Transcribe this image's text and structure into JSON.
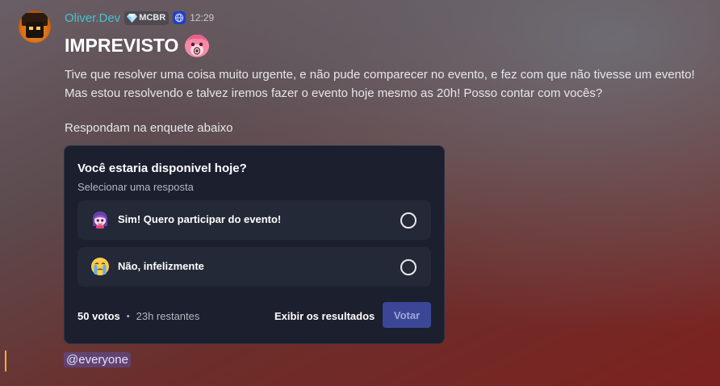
{
  "message": {
    "username": "Oliver.Dev",
    "guild_tag": "MCBR",
    "timestamp": "12:29",
    "title": "IMPREVISTO",
    "lines": [
      "Tive que resolver uma coisa muito urgente, e não pude comparecer no evento, e fez com que não tivesse um evento!",
      "Mas estou resolvendo e talvez iremos fazer o evento hoje mesmo as 20h! Posso contar com vocês?",
      "Respondam na enquete abaixo"
    ],
    "mention": "@everyone"
  },
  "poll": {
    "question": "Você estaria disponivel hoje?",
    "subtitle": "Selecionar uma resposta",
    "options": [
      {
        "label": "Sim! Quero participar do evento!",
        "icon": "anime-girl-emoji"
      },
      {
        "label": "Não, infelizmente",
        "icon": "crying-face-emoji"
      }
    ],
    "votes": "50 votos",
    "separator": "•",
    "remaining": "23h restantes",
    "show_results_label": "Exibir os resultados",
    "vote_label": "Votar"
  },
  "colors": {
    "username": "#47c3cf",
    "vote_button": "#3b4796",
    "poll_background": "#1b1f2e"
  }
}
